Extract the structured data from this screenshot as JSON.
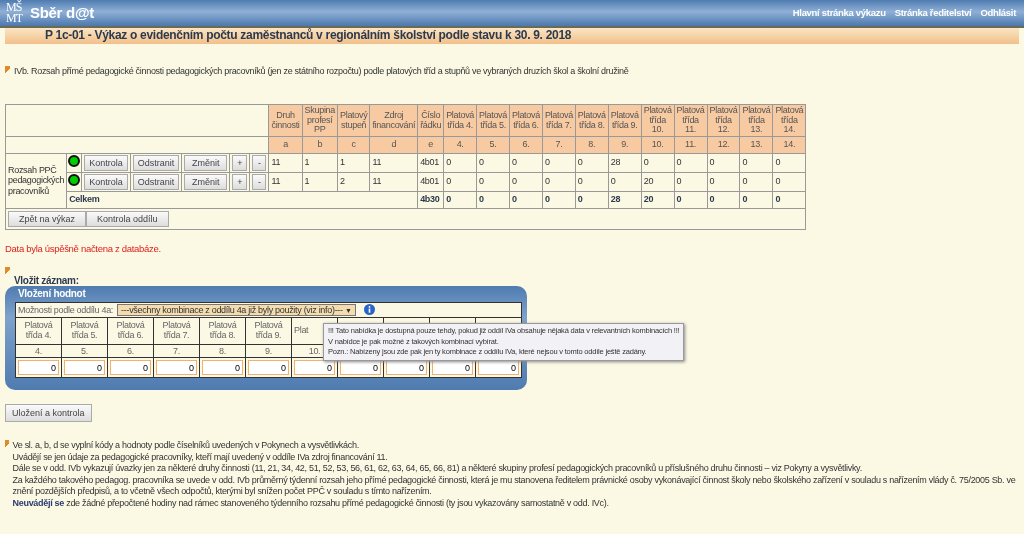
{
  "header": {
    "logo": [
      "MŠ",
      "MT"
    ],
    "app_name": "Sběr d@t",
    "nav": [
      "Hlavní stránka výkazu",
      "Stránka ředitelství",
      "Odhlásit"
    ]
  },
  "title": "P 1c-01 - Výkaz o evidenčním počtu zaměstnanců v regionálním školství podle stavu k 30. 9. 2018",
  "section_heading": "IVb. Rozsah přímé pedagogické činnosti pedagogických pracovníků (jen ze státního rozpočtu) podle platových tříd a stupňů ve vybraných druzích škol a školní družině",
  "table": {
    "columns": [
      {
        "label": "Druh činnosti",
        "code": "a"
      },
      {
        "label": "Skupina profesí PP",
        "code": "b"
      },
      {
        "label": "Platový stupeň",
        "code": "c"
      },
      {
        "label": "Zdroj financování",
        "code": "d"
      },
      {
        "label": "Číslo řádku",
        "code": "e"
      },
      {
        "label": "Platová třída 4.",
        "code": "4."
      },
      {
        "label": "Platová třída 5.",
        "code": "5."
      },
      {
        "label": "Platová třída 6.",
        "code": "6."
      },
      {
        "label": "Platová třída 7.",
        "code": "7."
      },
      {
        "label": "Platová třída 8.",
        "code": "8."
      },
      {
        "label": "Platová třída 9.",
        "code": "9."
      },
      {
        "label": "Platová třída 10.",
        "code": "10."
      },
      {
        "label": "Platová třída 11.",
        "code": "11."
      },
      {
        "label": "Platová třída 12.",
        "code": "12."
      },
      {
        "label": "Platová třída 13.",
        "code": "13."
      },
      {
        "label": "Platová třída 14.",
        "code": "14."
      }
    ],
    "row_group": "Rozsah PPČ pedagogických pracovníků",
    "rows": [
      {
        "color": "#00cc00",
        "buttons": [
          "Kontrola",
          "Odstranit",
          "Změnit",
          "+",
          "-"
        ],
        "cells": [
          "11",
          "1",
          "1",
          "11",
          "4b01",
          "0",
          "0",
          "0",
          "0",
          "0",
          "28",
          "0",
          "0",
          "0",
          "0",
          "0"
        ]
      },
      {
        "color": "#00cc00",
        "buttons": [
          "Kontrola",
          "Odstranit",
          "Změnit",
          "+",
          "-"
        ],
        "cells": [
          "11",
          "1",
          "2",
          "11",
          "4b01",
          "0",
          "0",
          "0",
          "0",
          "0",
          "0",
          "20",
          "0",
          "0",
          "0",
          "0"
        ]
      }
    ],
    "total": {
      "label": "Celkem",
      "cells": [
        "4b30",
        "0",
        "0",
        "0",
        "0",
        "0",
        "28",
        "20",
        "0",
        "0",
        "0",
        "0"
      ]
    },
    "footer_buttons": [
      "Zpět na výkaz",
      "Kontrola oddílu"
    ]
  },
  "message": "Data byla úspěšně načtena z databáze.",
  "insert": {
    "heading": "Vložit záznam:",
    "panel_title": "Vložení hodnot",
    "select_label": "Možnosti podle oddílu 4a:",
    "select_value": "---všechny kombinace z oddílu 4a již byly použity (viz info)---",
    "select_caret": "▼",
    "columns": [
      {
        "header": "Platová třída 4.",
        "number": "4.",
        "value": "0"
      },
      {
        "header": "Platová třída 5.",
        "number": "5.",
        "value": "0"
      },
      {
        "header": "Platová třída 6.",
        "number": "6.",
        "value": "0"
      },
      {
        "header": "Platová třída 7.",
        "number": "7.",
        "value": "0"
      },
      {
        "header": "Platová třída 8.",
        "number": "8.",
        "value": "0"
      },
      {
        "header": "Platová třída 9.",
        "number": "9.",
        "value": "0"
      },
      {
        "header": "Plat",
        "number": "10.",
        "value": "0"
      },
      {
        "value": "0"
      },
      {
        "value": "0"
      },
      {
        "value": "0"
      },
      {
        "value": "0"
      }
    ],
    "tooltip": [
      "!!! Tato  nabídka je dostupná pouze tehdy, pokud již oddíl IVa obsahuje nějaká data v relevantních kombinacích !!!",
      "V nabídce je pak možné z takových kombinací vybírat.",
      "Pozn.: Nabízeny jsou zde pak jen ty kombinace z oddílu IVa, které nejsou v tomto oddíle ještě zadány."
    ],
    "save_button": "Uložení a kontrola"
  },
  "notes": [
    "Ve sl. a, b, d se vyplní kódy a hodnoty podle číselníků uvedených v Pokynech a vysvětlivkách.",
    "Uvádějí se jen údaje za pedagogické pracovníky, kteří mají uvedený v oddíle IVa zdroj financování 11.",
    "Dále se v odd. IVb vykazují úvazky jen za některé druhy činnosti (11, 21, 34, 42, 51, 52, 53, 56, 61, 62, 63, 64, 65, 66, 81) a některé skupiny profesí pedagogických pracovníků u příslušného druhu činnosti – viz Pokyny a vysvětlivky.",
    "Za každého takového pedagog. pracovníka se uvede v odd. IVb průměrný týdenní rozsah jeho přímé pedagogické činnosti, která je mu stanovena ředitelem právnické osoby vykonávající činnost školy nebo školského zařízení v souladu s nařízením vlády č. 75/2005 Sb. ve znění pozdějších předpisů, a to včetně všech odpočtů, kterými byl snížen počet PPČ v souladu s tímto nařízením.",
    "**Neuvádějí se** zde žádné přepočtené hodiny nad rámec stanoveného týdenního rozsahu přímé pedagogické činnosti (ty jsou vykazovány samostatně v odd. IVc)."
  ]
}
